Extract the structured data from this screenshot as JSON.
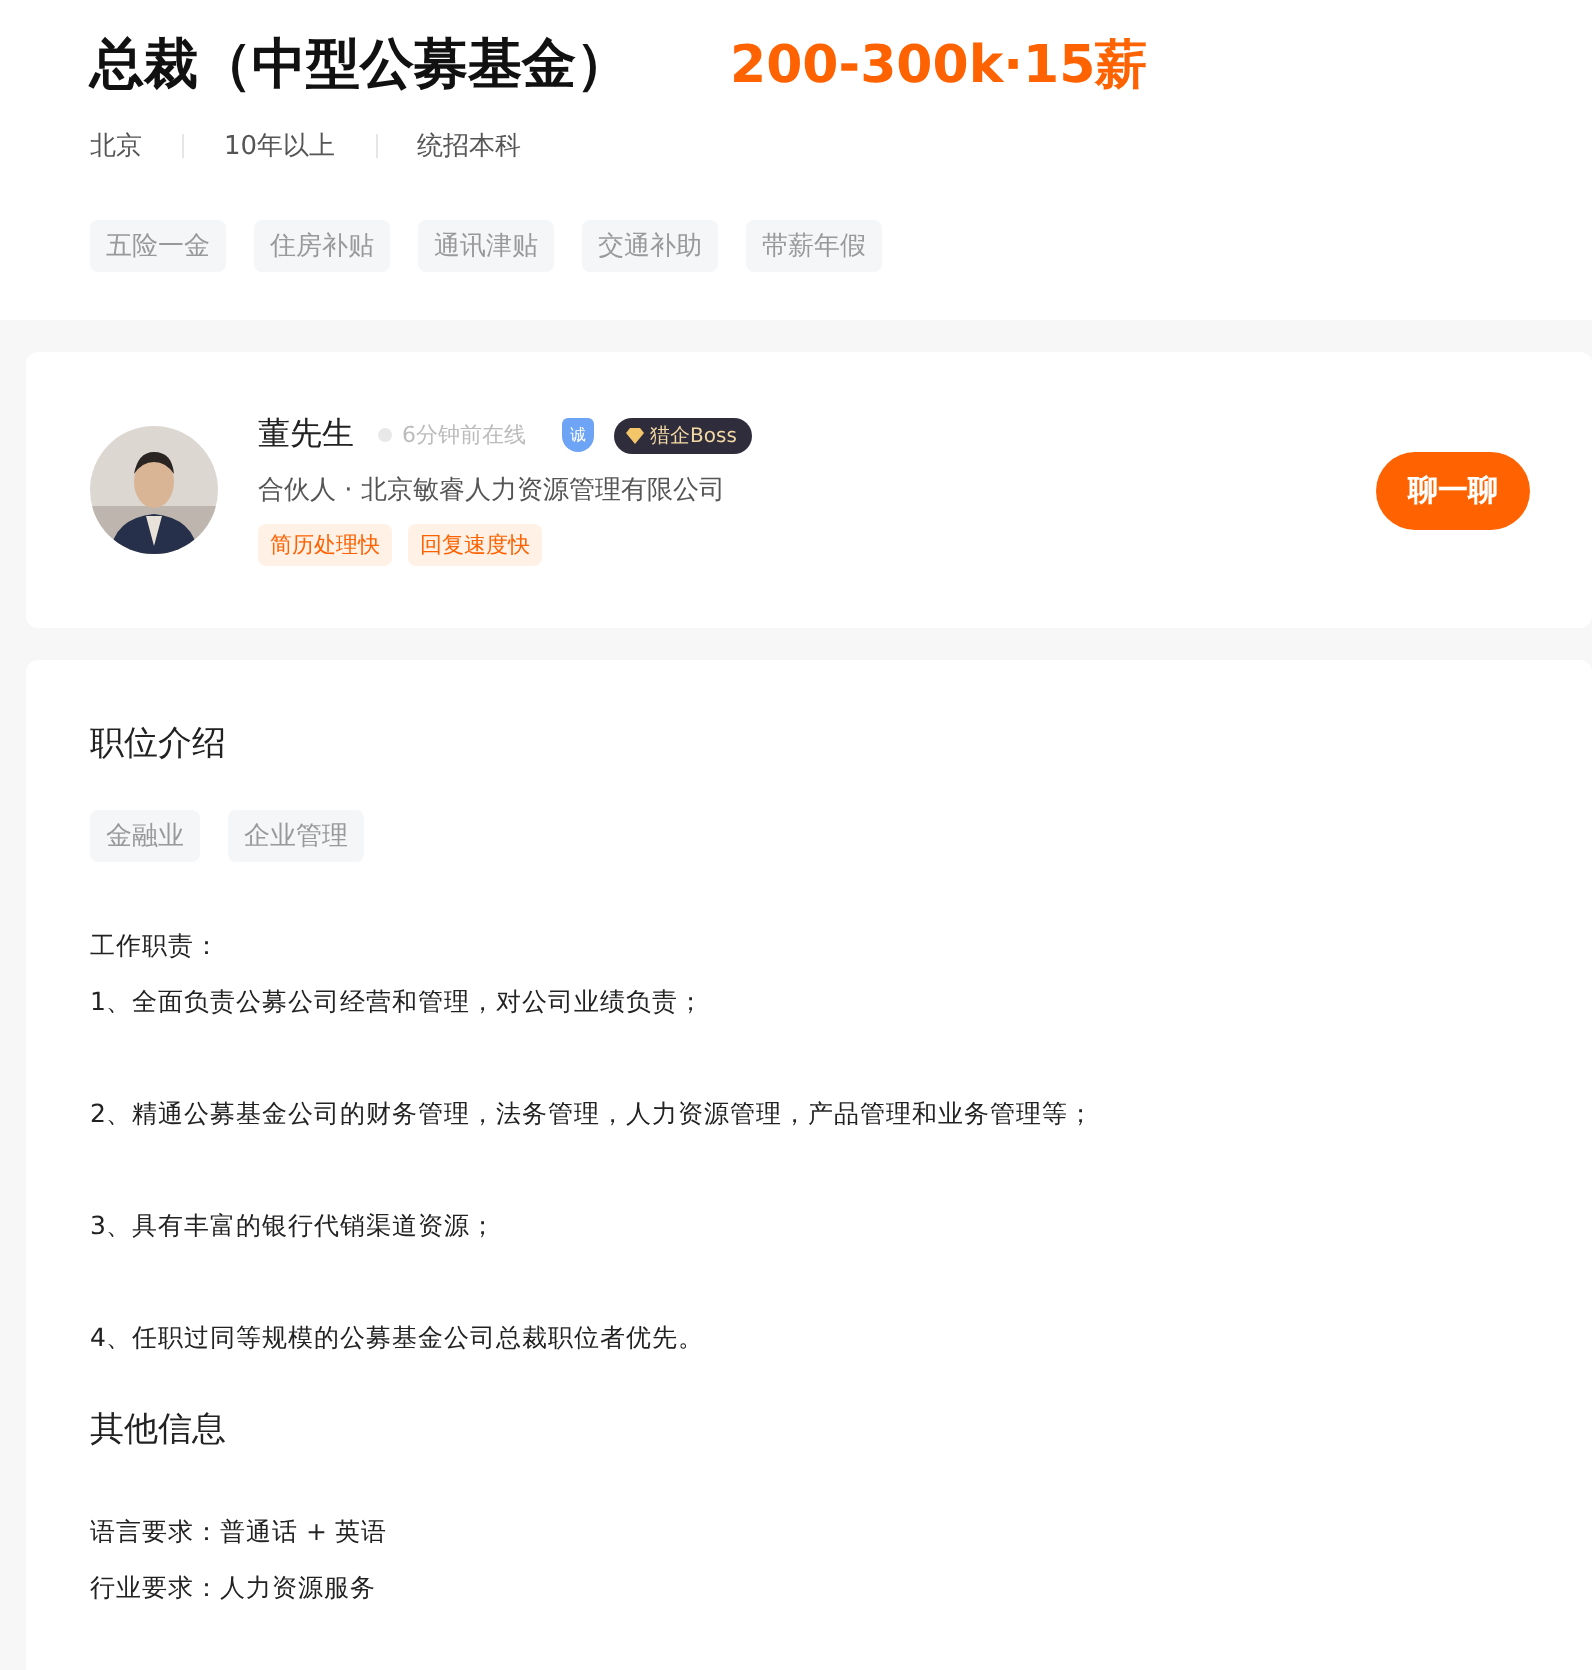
{
  "job": {
    "title": "总裁（中型公募基金）",
    "salary": "200-300k·15薪",
    "meta": [
      "北京",
      "10年以上",
      "统招本科"
    ],
    "benefits": [
      "五险一金",
      "住房补贴",
      "通讯津贴",
      "交通补助",
      "带薪年假"
    ]
  },
  "recruiter": {
    "avatar": {
      "kind": "picture"
    },
    "name": "董先生",
    "online": "6分钟前在线",
    "verified_mark": "诚",
    "badge": "猎企Boss",
    "company": "合伙人 · 北京敏睿人力资源管理有限公司",
    "tags": [
      "简历处理快",
      "回复速度快"
    ],
    "chat_button": "聊一聊"
  },
  "description": {
    "heading": "职位介绍",
    "tags": [
      "金融业",
      "企业管理"
    ],
    "lines": [
      "工作职责：",
      "1、全面负责公募公司经营和管理，对公司业绩负责；",
      "2、精通公募基金公司的财务管理，法务管理，人力资源管理，产品管理和业务管理等；",
      "3、具有丰富的银行代销渠道资源；",
      "4、任职过同等规模的公募基金公司总裁职位者优先。"
    ]
  },
  "other": {
    "heading": "其他信息",
    "items": [
      "语言要求：普通话 + 英语",
      "行业要求：人力资源服务"
    ]
  }
}
